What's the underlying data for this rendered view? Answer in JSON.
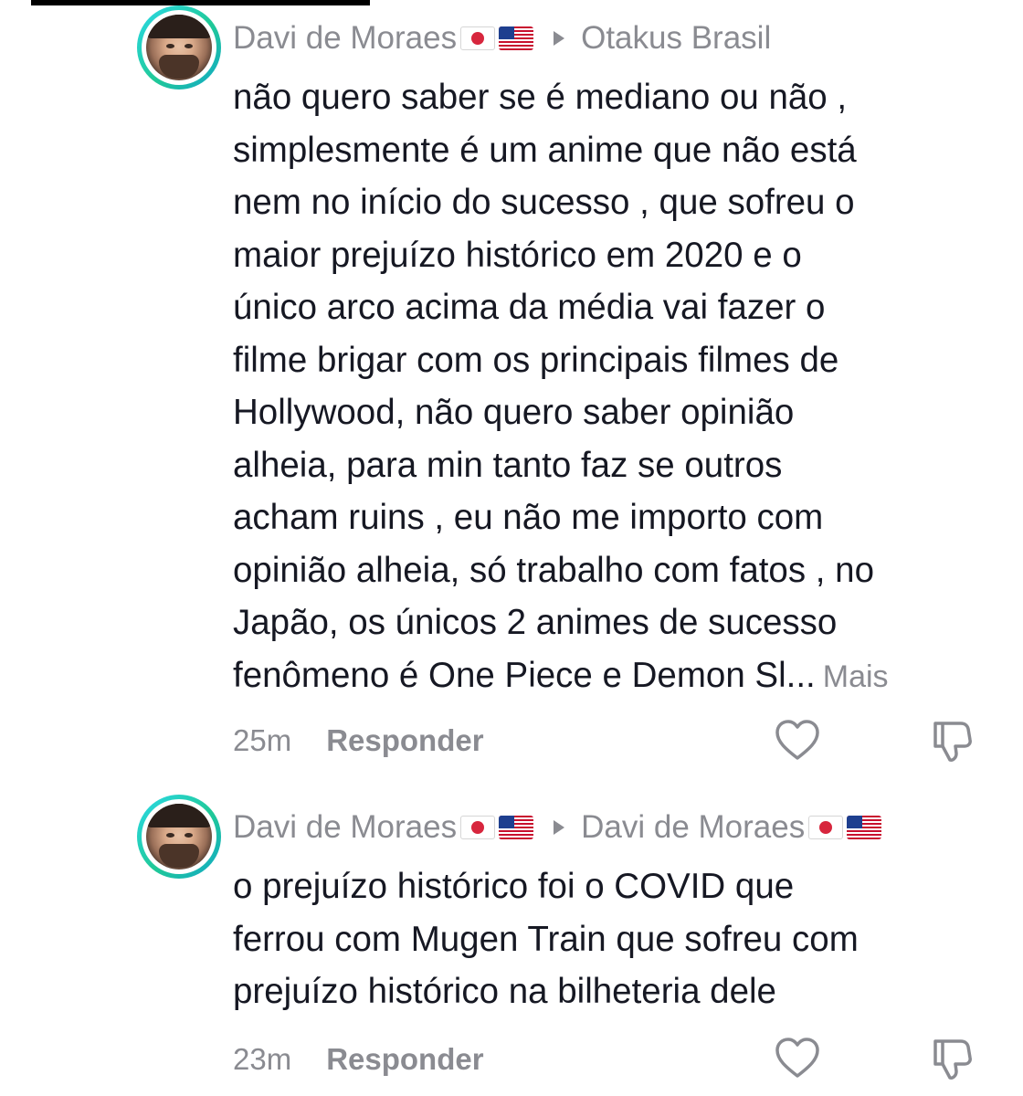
{
  "comments": [
    {
      "username": "Davi de Moraes",
      "reply_to": "Otakus Brasil",
      "reply_to_has_flags": false,
      "text_lines": [
        "não quero saber se é mediano ou não ,",
        "simplesmente é um anime que não está",
        "nem no início do sucesso , que sofreu o",
        "maior prejuízo histórico em 2020 e o",
        "único arco acima da média vai fazer o",
        "filme brigar com os principais filmes de",
        "Hollywood, não quero saber opinião",
        "alheia, para min tanto faz se outros",
        "acham ruins , eu não me importo com",
        "opinião alheia, só trabalho com fatos , no",
        "Japão, os únicos 2 animes de sucesso",
        "fenômeno é One Piece e Demon Sl..."
      ],
      "more_label": "Mais",
      "time": "25m",
      "reply_label": "Responder"
    },
    {
      "username": "Davi de Moraes",
      "reply_to": "Davi de Moraes",
      "reply_to_has_flags": true,
      "text_lines": [
        "o prejuízo histórico foi o COVID que",
        "ferrou com Mugen Train que sofreu com",
        "prejuízo histórico na bilheteria dele"
      ],
      "time": "23m",
      "reply_label": "Responder"
    }
  ],
  "icons": {
    "like": "heart-outline-icon",
    "dislike": "thumbs-down-outline-icon",
    "reply_arrow": "play-arrow-icon"
  },
  "colors": {
    "text": "#161823",
    "muted": "#8a8b91",
    "avatar_ring": "#20c997"
  }
}
